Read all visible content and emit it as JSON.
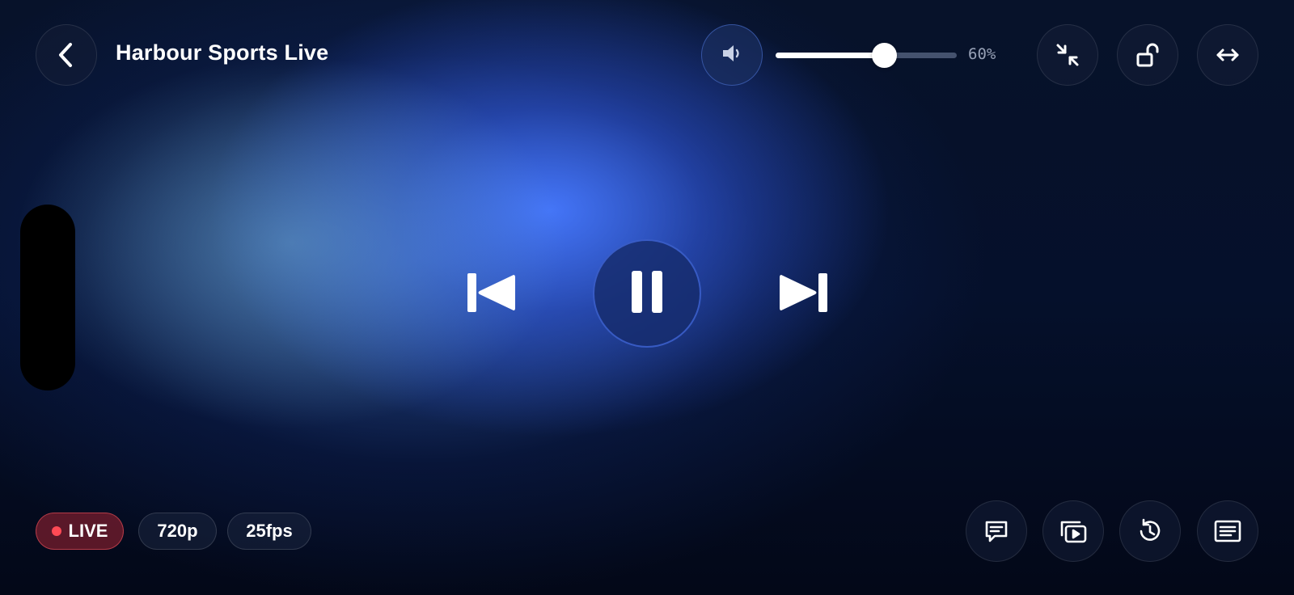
{
  "header": {
    "title": "Harbour Sports Live",
    "back_icon": "chevron-left-icon"
  },
  "volume": {
    "icon": "speaker-low-icon",
    "level": 0.6,
    "label": "60%"
  },
  "top_actions": [
    {
      "name": "exit-fullscreen-button",
      "icon": "collapse-arrows-icon"
    },
    {
      "name": "unlock-button",
      "icon": "unlock-icon"
    },
    {
      "name": "fit-width-button",
      "icon": "horizontal-arrows-icon"
    }
  ],
  "playback": {
    "previous_icon": "skip-previous-icon",
    "pause_icon": "pause-icon",
    "next_icon": "skip-next-icon"
  },
  "stream_info": {
    "live_label": "LIVE",
    "resolution": "720p",
    "framerate": "25fps"
  },
  "bottom_actions": [
    {
      "name": "chat-button",
      "icon": "chat-bubble-icon"
    },
    {
      "name": "picture-in-picture-button",
      "icon": "video-stack-icon"
    },
    {
      "name": "history-button",
      "icon": "history-icon"
    },
    {
      "name": "playlist-button",
      "icon": "list-icon"
    }
  ],
  "colors": {
    "accent": "#4a78ff",
    "live": "#ff4a55"
  }
}
